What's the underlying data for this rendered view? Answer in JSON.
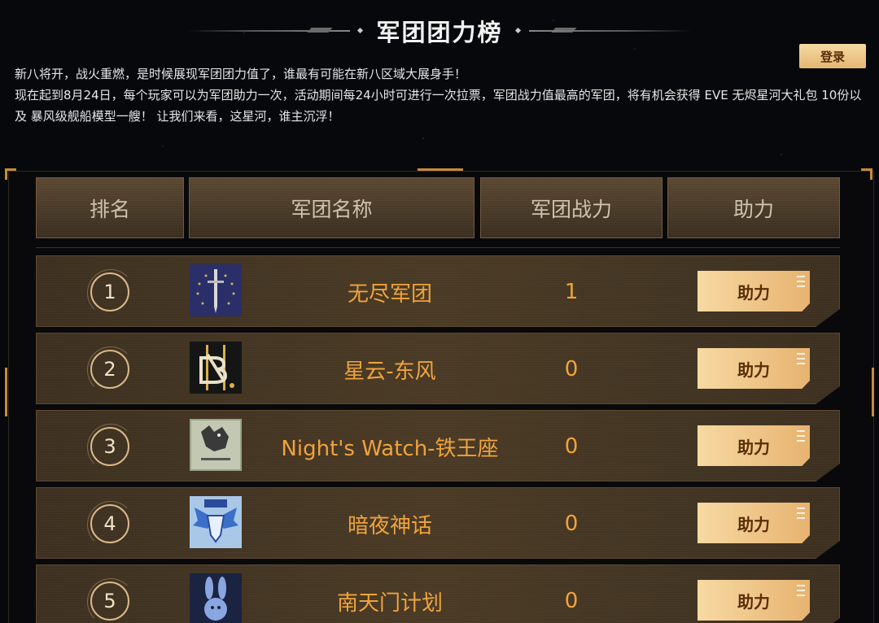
{
  "page": {
    "title": "军团团力榜",
    "login_label": "登录",
    "intro_line1": "新八将开，战火重燃，是时候展现军团团力值了，谁最有可能在新八区域大展身手！",
    "intro_line2": "现在起到8月24日，每个玩家可以为军团助力一次，活动期间每24小时可进行一次拉票，军团战力值最高的军团，将有机会获得 EVE 无烬星河大礼包 10份以及 暴风级舰船模型一艘！ 让我们来看，这星河，谁主沉浮！"
  },
  "table": {
    "headers": [
      "排名",
      "军团名称",
      "军团战力",
      "助力"
    ],
    "rows": [
      {
        "rank": "1",
        "name": "无尽军团",
        "power": "1",
        "action": "助力",
        "logo_icon": "sword-emblem-icon"
      },
      {
        "rank": "2",
        "name": "星云-东风",
        "power": "0",
        "action": "助力",
        "logo_icon": "nb-monogram-icon"
      },
      {
        "rank": "3",
        "name": "Night's Watch-铁王座",
        "power": "0",
        "action": "助力",
        "logo_icon": "direwolf-sigil-icon"
      },
      {
        "rank": "4",
        "name": "暗夜神话",
        "power": "0",
        "action": "助力",
        "logo_icon": "moom-wings-icon"
      },
      {
        "rank": "5",
        "name": "南天门计划",
        "power": "0",
        "action": "助力",
        "logo_icon": "rabbit-emblem-icon"
      }
    ]
  },
  "colors": {
    "accent": "#f0a33c",
    "button": "#e7b370",
    "frame": "#c88a3a"
  }
}
